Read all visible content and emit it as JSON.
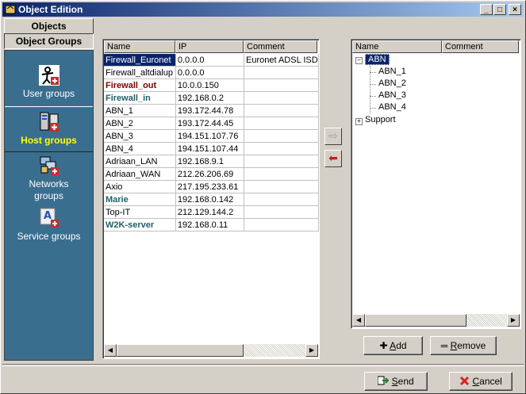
{
  "window": {
    "title": "Object Edition"
  },
  "nav": {
    "tabs": [
      {
        "label": "Objects"
      },
      {
        "label": "Object Groups"
      }
    ],
    "items": [
      {
        "label": "User groups",
        "icon": "user-group-icon"
      },
      {
        "label": "Host groups",
        "icon": "host-group-icon"
      },
      {
        "label": "Networks groups",
        "icon": "network-group-icon"
      },
      {
        "label": "Service groups",
        "icon": "service-group-icon"
      }
    ],
    "active": "Host groups"
  },
  "objects_list": {
    "columns": [
      "Name",
      "IP",
      "Comment"
    ],
    "rows": [
      {
        "name": "Firewall_Euronet",
        "ip": "0.0.0.0",
        "comment": "Euronet ADSL ISD",
        "style": "selected"
      },
      {
        "name": "Firewall_altdialup",
        "ip": "0.0.0.0",
        "comment": "",
        "style": "normal"
      },
      {
        "name": "Firewall_out",
        "ip": "10.0.0.150",
        "comment": "",
        "style": "bold-red"
      },
      {
        "name": "Firewall_in",
        "ip": "192.168.0.2",
        "comment": "",
        "style": "bold-teal"
      },
      {
        "name": "ABN_1",
        "ip": "193.172.44.78",
        "comment": "",
        "style": "normal"
      },
      {
        "name": "ABN_2",
        "ip": "193.172.44.45",
        "comment": "",
        "style": "normal"
      },
      {
        "name": "ABN_3",
        "ip": "194.151.107.76",
        "comment": "",
        "style": "normal"
      },
      {
        "name": "ABN_4",
        "ip": "194.151.107.44",
        "comment": "",
        "style": "normal"
      },
      {
        "name": "Adriaan_LAN",
        "ip": "192.168.9.1",
        "comment": "",
        "style": "normal"
      },
      {
        "name": "Adriaan_WAN",
        "ip": "212.26.206.69",
        "comment": "",
        "style": "normal"
      },
      {
        "name": "Axio",
        "ip": "217.195.233.61",
        "comment": "",
        "style": "normal"
      },
      {
        "name": "Marie",
        "ip": "192.168.0.142",
        "comment": "",
        "style": "bold-teal"
      },
      {
        "name": "Top-IT",
        "ip": "212.129.144.2",
        "comment": "",
        "style": "normal"
      },
      {
        "name": "W2K-server",
        "ip": "192.168.0.11",
        "comment": "",
        "style": "bold-teal"
      }
    ]
  },
  "transfer": {
    "add_arrow": "⇨",
    "remove_arrow": "⬅"
  },
  "group_tree": {
    "columns": [
      "Name",
      "Comment"
    ],
    "root": {
      "label": "ABN",
      "expander": "−",
      "children": [
        "ABN_1",
        "ABN_2",
        "ABN_3",
        "ABN_4"
      ]
    },
    "second": {
      "label": "Support",
      "expander": "+"
    }
  },
  "buttons": {
    "add": {
      "prefix": "✚ ",
      "accel": "A",
      "rest": "dd"
    },
    "remove": {
      "prefix": "═ ",
      "accel": "R",
      "rest": "emove"
    },
    "send": {
      "accel": "S",
      "rest": "end"
    },
    "cancel": {
      "accel": "C",
      "rest": "ancel"
    }
  },
  "colors": {
    "nav_panel": "#3a6e8f",
    "active_label": "#ffff00",
    "selection": "#0a246a"
  }
}
